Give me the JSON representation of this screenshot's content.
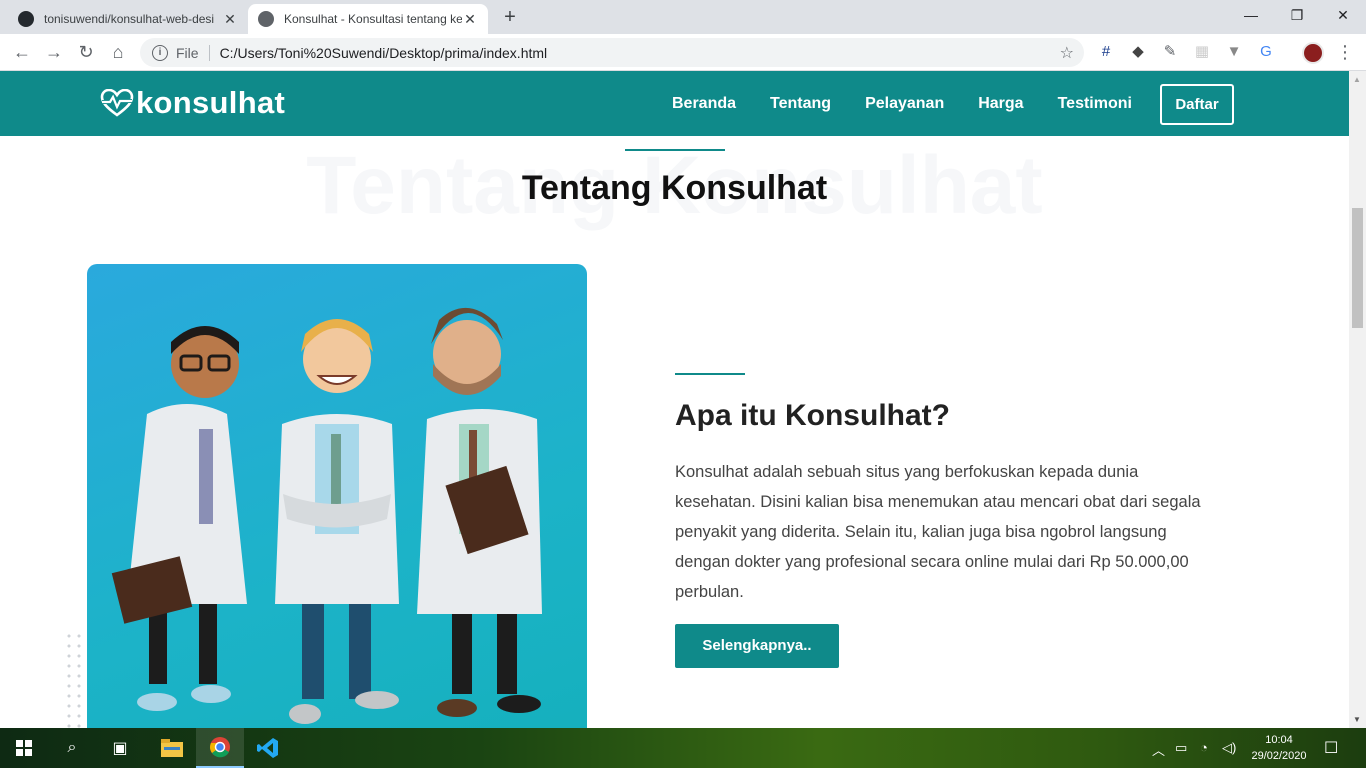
{
  "browser": {
    "tabs": [
      {
        "title": "tonisuwendi/konsulhat-web-desi",
        "icon": "github-icon"
      },
      {
        "title": "Konsulhat - Konsultasi tentang ke",
        "icon": "globe-icon"
      }
    ],
    "new_tab_symbol": "+",
    "window_controls": {
      "minimize": "—",
      "restore": "❐",
      "close": "✕"
    },
    "address": {
      "scheme_label": "File",
      "url": "C:/Users/Toni%20Suwendi/Desktop/prima/index.html"
    }
  },
  "site": {
    "brand": "konsulhat",
    "nav": [
      {
        "label": "Beranda"
      },
      {
        "label": "Tentang"
      },
      {
        "label": "Pelayanan"
      },
      {
        "label": "Harga"
      },
      {
        "label": "Testimoni"
      }
    ],
    "cta": "Daftar",
    "section": {
      "ghost_title": "Tentang Konsulhat",
      "title": "Tentang Konsulhat"
    },
    "about": {
      "title": "Apa itu Konsulhat?",
      "text": "Konsulhat adalah sebuah situs yang berfokuskan kepada dunia kesehatan. Disini kalian bisa menemukan atau mencari obat dari segala penyakit yang diderita. Selain itu, kalian juga bisa ngobrol langsung dengan dokter yang profesional secara online mulai dari Rp 50.000,00 perbulan.",
      "button": "Selengkapnya.."
    },
    "colors": {
      "primary": "#0f8a8a",
      "card_gradient_start": "#2aa9dd",
      "card_gradient_end": "#15b0bd"
    }
  },
  "taskbar": {
    "time": "10:04",
    "date": "29/02/2020"
  }
}
